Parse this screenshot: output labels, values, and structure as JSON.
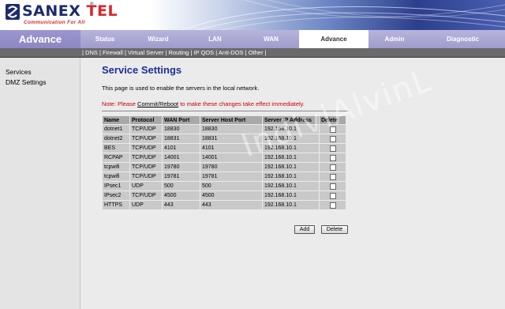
{
  "brand": {
    "logo_main": "SANEX",
    "logo_accent": "TEL",
    "logo_reg": "®",
    "tagline": "Communication For All"
  },
  "nav": {
    "section": "Advance",
    "tabs": [
      {
        "label": "Status",
        "active": false
      },
      {
        "label": "Wizard",
        "active": false
      },
      {
        "label": "LAN",
        "active": false
      },
      {
        "label": "WAN",
        "active": false
      },
      {
        "label": "Advance",
        "active": true
      },
      {
        "label": "Admin",
        "active": false
      },
      {
        "label": "Diagnostic",
        "active": false
      }
    ]
  },
  "submenu": {
    "sep": "|",
    "items": [
      "DNS",
      "Firewall",
      "Virtual Server",
      "Routing",
      "IP QOS",
      "Anti-DOS",
      "Other"
    ]
  },
  "sidebar": {
    "items": [
      "Services",
      "DMZ Settings"
    ]
  },
  "main": {
    "title": "Service Settings",
    "description": "This page is used to enable the servers in the local network.",
    "note_prefix": "Note: Please ",
    "note_link": "Commit/Reboot",
    "note_suffix": " to make these changes take effect immediately.",
    "table": {
      "headers": [
        "Name",
        "Protocol",
        "WAN Port",
        "Server Host Port",
        "Server IP Address",
        "Delete"
      ],
      "rows": [
        [
          "dotnet1",
          "TCP/UDP",
          "18830",
          "18830",
          "192.168.10.1"
        ],
        [
          "dotnet2",
          "TCP/UDP",
          "18831",
          "18831",
          "192.168.10.1"
        ],
        [
          "BES",
          "TCP/UDP",
          "4101",
          "4101",
          "192.168.10.1"
        ],
        [
          "RCPAP",
          "TCP/UDP",
          "14001",
          "14001",
          "192.168.10.1"
        ],
        [
          "tcpwifi",
          "TCP/UDP",
          "19780",
          "19780",
          "192.168.10.1"
        ],
        [
          "tcpwifi",
          "TCP/UDP",
          "19781",
          "19781",
          "192.168.10.1"
        ],
        [
          "IPsec1",
          "UDP",
          "500",
          "500",
          "192.168.10.1"
        ],
        [
          "IPsec2",
          "TCP/UDP",
          "4500",
          "4500",
          "192.168.10.1"
        ],
        [
          "HTTPS",
          "UDP",
          "443",
          "443",
          "192.168.10.1"
        ]
      ]
    },
    "add_label": "Add",
    "delete_label": "Delete"
  },
  "watermark": "IndiviAlvinL",
  "colors": {
    "nav_bg": "#a09ccd",
    "title": "#1f2f96",
    "note": "#cc0000",
    "logo_blue": "#1e2a6e",
    "logo_red": "#d9272a"
  }
}
